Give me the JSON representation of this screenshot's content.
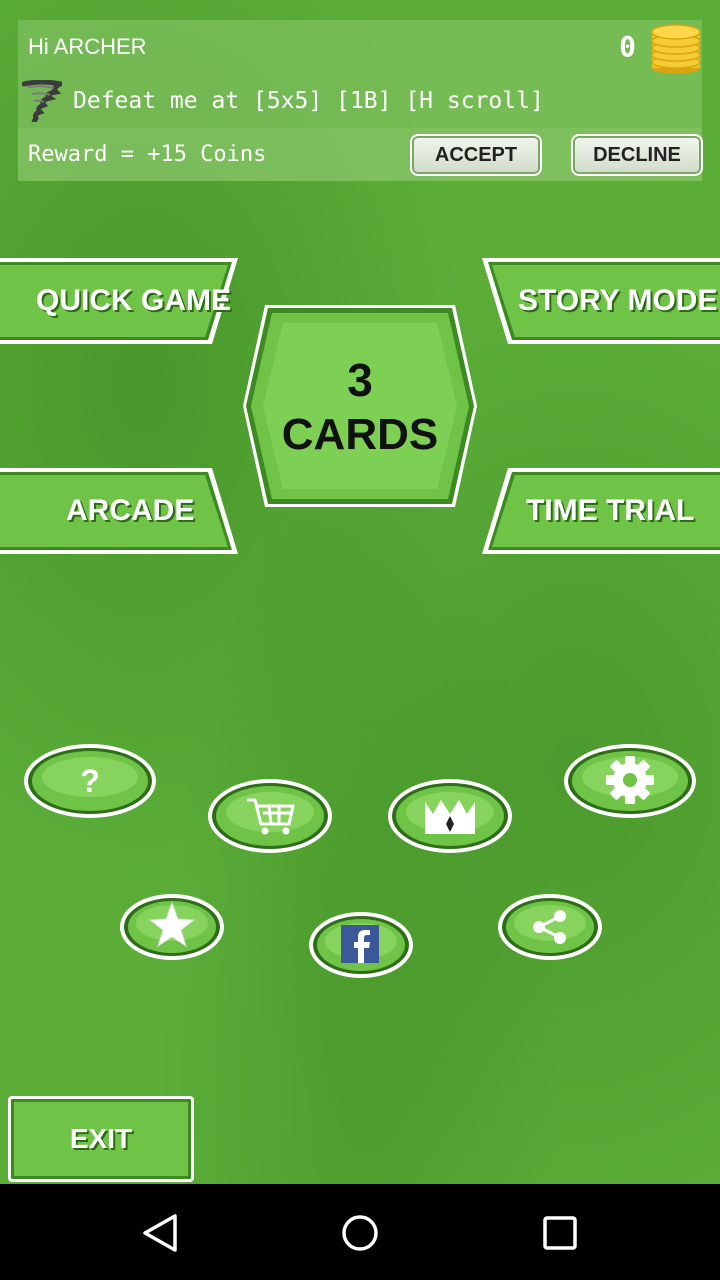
{
  "challenge": {
    "greeting": "Hi ARCHER",
    "coins": "0",
    "text": "Defeat me at [5x5] [1B] [H scroll]",
    "reward": "Reward = +15 Coins",
    "accept_label": "ACCEPT",
    "decline_label": "DECLINE"
  },
  "modes": {
    "quick_game": "QUICK GAME",
    "story_mode": "STORY MODE",
    "arcade": "ARCADE",
    "time_trial": "TIME TRIAL"
  },
  "title": {
    "line1": "3",
    "line2": "CARDS"
  },
  "round_buttons": {
    "help": "?",
    "icons": [
      "question-mark",
      "cart-icon",
      "crown-icon",
      "gear-icon",
      "star-icon",
      "facebook-icon",
      "share-icon"
    ]
  },
  "exit_label": "EXIT",
  "colors": {
    "background": "#5bad38",
    "button_fill": "#6fc447",
    "button_border": "#ffffff",
    "coin": "#f2c21e"
  }
}
